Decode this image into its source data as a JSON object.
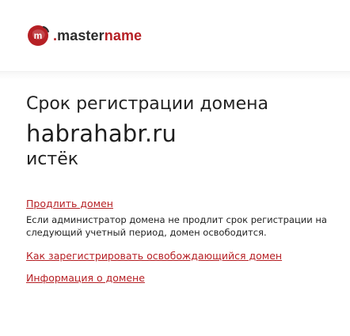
{
  "brand": {
    "dot": ".",
    "master": "master",
    "name": "name",
    "logo_icon": "masterhost-logo-icon",
    "accent_color": "#b62025"
  },
  "notice": {
    "headline": "Срок регистрации домена",
    "domain": "habrahabr.ru",
    "status": "истёк"
  },
  "actions": {
    "renew_link": "Продлить домен",
    "renew_description": "Если администратор домена не продлит срок регистрации на следующий учетный период, домен освободится.",
    "register_link": "Как зарегистрировать освобождающийся домен",
    "info_link": "Информация о домене"
  }
}
